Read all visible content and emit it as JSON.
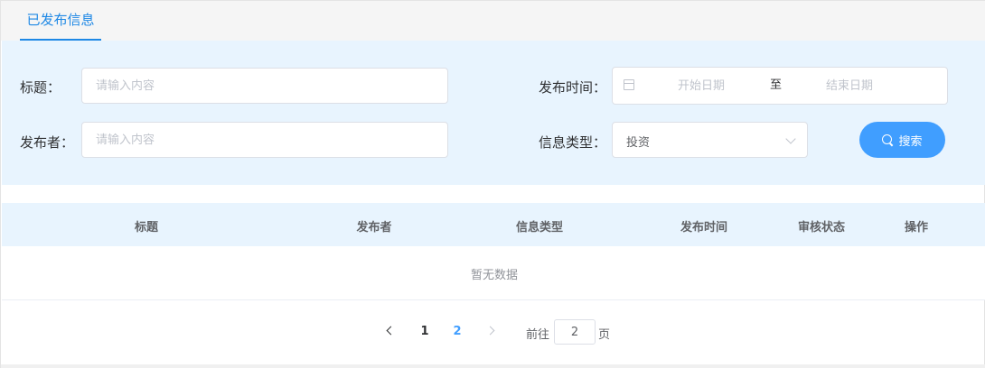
{
  "tabs": [
    {
      "label": "已发布信息",
      "active": true
    }
  ],
  "filters": {
    "title_label": "标题：",
    "title_placeholder": "请输入内容",
    "publisher_label": "发布者：",
    "publisher_placeholder": "请输入内容",
    "time_label": "发布时间：",
    "start_placeholder": "开始日期",
    "range_separator": "至",
    "end_placeholder": "结束日期",
    "type_label": "信息类型：",
    "type_value": "投资",
    "search_label": "搜索"
  },
  "table": {
    "columns": [
      "标题",
      "发布者",
      "信息类型",
      "发布时间",
      "审核状态",
      "操作"
    ],
    "rows": [],
    "empty_text": "暂无数据"
  },
  "pagination": {
    "pages": [
      "1",
      "2"
    ],
    "current_page": "2",
    "goto_prefix": "前往",
    "goto_value": "2",
    "goto_suffix": "页"
  },
  "colors": {
    "accent": "#409eff",
    "tab_active": "#1e88e5",
    "panel_bg": "#e8f4fe"
  }
}
